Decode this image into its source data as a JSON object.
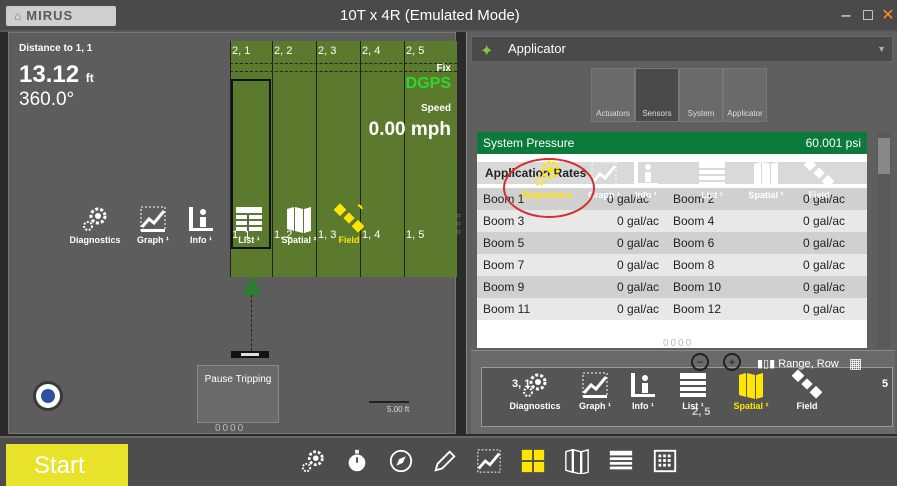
{
  "window": {
    "logo": "MIRUS",
    "title": "10T x 4R (Emulated Mode)"
  },
  "map": {
    "distance_label": "Distance to 1, 1",
    "distance_value": "13.12",
    "distance_unit": "ft",
    "heading": "360.0°",
    "fix_label": "Fix",
    "fix_value": "DGPS",
    "speed_label": "Speed",
    "speed_value": "0.00 mph",
    "field_columns": [
      "2, 1",
      "2, 2",
      "2, 3",
      "2, 4",
      "2, 5"
    ],
    "field_bottom_labels": [
      "1, 1",
      "1, 2",
      "1, 3",
      "1, 4",
      "1, 5"
    ],
    "pause_label": "Pause Tripping",
    "scale_label": "5.00 ft",
    "page_dots": "0000"
  },
  "icon_strip": {
    "items": [
      "Diagnostics",
      "Graph ¹",
      "Info ¹",
      "List ¹",
      "Spatial ²",
      "Field"
    ],
    "active": "Field"
  },
  "right_panel": {
    "dropdown": "Applicator",
    "tabs": [
      "Actuators",
      "Sensors",
      "System",
      "Applicator"
    ],
    "active_tab": "Sensors",
    "system_pressure_label": "System Pressure",
    "system_pressure_value": "60.001 psi",
    "section_label": "Application Rates",
    "rows": [
      {
        "a": "Boom 1",
        "av": "0 gal/ac",
        "b": "Boom 2",
        "bv": "0 gal/ac"
      },
      {
        "a": "Boom 3",
        "av": "0 gal/ac",
        "b": "Boom 4",
        "bv": "0 gal/ac"
      },
      {
        "a": "Boom 5",
        "av": "0 gal/ac",
        "b": "Boom 6",
        "bv": "0 gal/ac"
      },
      {
        "a": "Boom 7",
        "av": "0 gal/ac",
        "b": "Boom 8",
        "bv": "0 gal/ac"
      },
      {
        "a": "Boom 9",
        "av": "0 gal/ac",
        "b": "Boom 10",
        "bv": "0 gal/ac"
      },
      {
        "a": "Boom 11",
        "av": "0 gal/ac",
        "b": "Boom 12",
        "bv": "0 gal/ac"
      }
    ],
    "strip_top": [
      "Diagnostics",
      "Graph ¹",
      "Info ¹",
      "List ¹",
      "Spatial ²",
      "Field"
    ],
    "strip_top_active": "Diagnostics",
    "strip_bottom": [
      "Diagnostics",
      "Graph ¹",
      "Info ¹",
      "List ¹",
      "Spatial ²",
      "Field"
    ],
    "strip_bottom_active": "Spatial ²",
    "mini_range_label": "Range, Row",
    "mini_cells": [
      "3, 1",
      "2, 5",
      "5"
    ],
    "page_dots": "0000"
  },
  "bottom_bar": {
    "start_label": "Start"
  },
  "colors": {
    "accent_yellow": "#ffe600",
    "start_yellow": "#e8e22a",
    "field_green": "#5b7a2e",
    "pressure_green": "#0b7a3a",
    "highlight_red": "#d32f2f"
  }
}
